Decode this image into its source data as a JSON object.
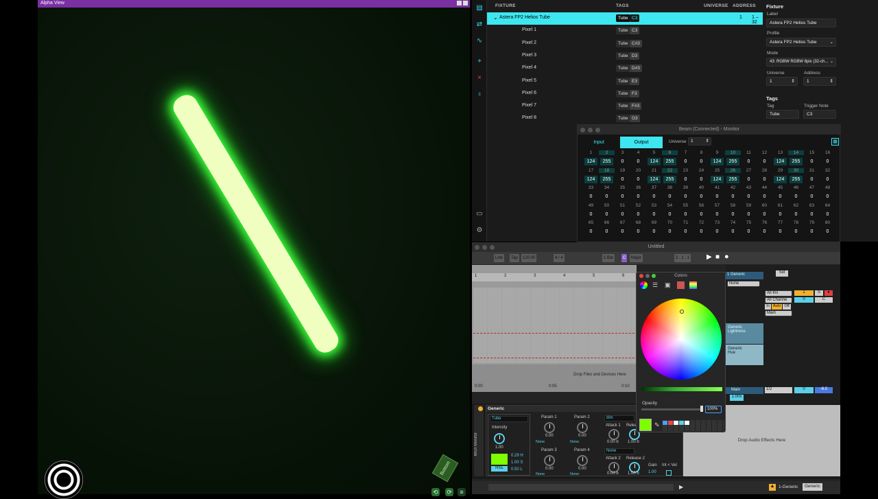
{
  "alpha_view": {
    "title": "Alpha View",
    "cube_label": "Bottom"
  },
  "fixtures": {
    "headers": {
      "fixture": "FIXTURE",
      "tags": "TAGS",
      "universe": "UNIVERSE",
      "address": "ADDRESS"
    },
    "rows": [
      {
        "name": "Astera FP2 Helios Tube",
        "tag": "Tube",
        "note": "C3",
        "universe": "1",
        "address": "1 – 32"
      },
      {
        "name": "Pixel 1",
        "tag": "Tube",
        "note": "C3"
      },
      {
        "name": "Pixel 2",
        "tag": "Tube",
        "note": "C#3"
      },
      {
        "name": "Pixel 3",
        "tag": "Tube",
        "note": "D3"
      },
      {
        "name": "Pixel 4",
        "tag": "Tube",
        "note": "D#3"
      },
      {
        "name": "Pixel 5",
        "tag": "Tube",
        "note": "E3"
      },
      {
        "name": "Pixel 6",
        "tag": "Tube",
        "note": "F3"
      },
      {
        "name": "Pixel 7",
        "tag": "Tube",
        "note": "F#3"
      },
      {
        "name": "Pixel 8",
        "tag": "Tube",
        "note": "G3"
      }
    ]
  },
  "inspector": {
    "heading": "Fixture",
    "label_caption": "Label",
    "label_value": "Astera FP2 Helios Tube",
    "profile_caption": "Profile",
    "profile_value": "Astera FP2 Helios Tube",
    "mode_caption": "Mode",
    "mode_value": "43: RGBW RGBW 8pix (32-ch...",
    "universe_caption": "Universe",
    "universe_value": "1",
    "address_caption": "Address",
    "address_value": "1",
    "tags_heading": "Tags",
    "tag_caption": "Tag",
    "tag_value": "Tube",
    "trigger_caption": "Trigger Note",
    "trigger_value": "C3"
  },
  "monitor": {
    "title": "Beam (Connected) - Monitor",
    "tab_input": "Input",
    "tab_output": "Output",
    "universe_label": "Universe",
    "universe_value": "1",
    "channels": [
      [
        124,
        255,
        0,
        0,
        124,
        255,
        0,
        0,
        124,
        255,
        0,
        0,
        124,
        255,
        0,
        0
      ],
      [
        124,
        255,
        0,
        0,
        124,
        255,
        0,
        0,
        124,
        255,
        0,
        0,
        124,
        255,
        0,
        0
      ],
      [
        0,
        0,
        0,
        0,
        0,
        0,
        0,
        0,
        0,
        0,
        0,
        0,
        0,
        0,
        0,
        0
      ],
      [
        0,
        0,
        0,
        0,
        0,
        0,
        0,
        0,
        0,
        0,
        0,
        0,
        0,
        0,
        0,
        0
      ],
      [
        0,
        0,
        0,
        0,
        0,
        0,
        0,
        0,
        0,
        0,
        0,
        0,
        0,
        0,
        0,
        0
      ]
    ]
  },
  "ableton": {
    "title": "Untitled",
    "link": "Link",
    "tap": "Tap",
    "tempo": "120.00",
    "signature": "4 / 4",
    "quant": "1 Bar",
    "key": "C",
    "scale": "Major",
    "position": "2 . 1 . 1",
    "ruler": [
      "1",
      "2",
      "3",
      "4",
      "5",
      "6"
    ],
    "time_start": "0:00",
    "time_mid": "0:05",
    "time_end": "0:10",
    "drop_files": "Drop Files and Devices Here",
    "drop_fx": "Drop Audio Effects Here",
    "track_name": "1 Generic",
    "track_input": "None",
    "ch_lightness": "Generic\nLightness",
    "ch_hue": "Generic\nHue",
    "all_ins": "All Ins",
    "all_channels": "All Channe",
    "main": "Main",
    "main_track": "Main",
    "ratio": "1/2",
    "vol_main": "-6.0",
    "vol_track": "0",
    "c_label": "C",
    "s_label": "S",
    "in_label": "In",
    "auto_label": "Auto",
    "off_label": "Off",
    "tempo_pct": "1.00x",
    "set_label": "Set",
    "device": {
      "title": "Generic",
      "side_label": "MIDI Monitor",
      "tag": "Tube",
      "intensity_label": "Intensity",
      "intensity_value": "1.00",
      "h": "0.29 H",
      "s": "1.00 S",
      "l": "0.50 L",
      "mode": "HSL",
      "param1": "Param 1",
      "param1_val": "0.00",
      "param1_sel": "None",
      "param2": "Param 2",
      "param2_val": "0.00",
      "param2_sel": "None",
      "param3": "Param 3",
      "param3_val": "0.00",
      "param3_sel": "None",
      "param4": "Param 4",
      "param4_val": "0.00",
      "param4_sel": "None",
      "dim": "dim",
      "attack1": "Attack 1",
      "attack1_val": "0.00 b",
      "release1": "Release 1",
      "release1_val": "1.00 b",
      "sel_none": "None",
      "attack2": "Attack 2",
      "attack2_val": "0.00 b",
      "release2": "Release 2",
      "release2_val": "1.00 b",
      "gain": "Gain",
      "gain_val": "1.00",
      "int_vel": "Int < Vel"
    },
    "status_track": "1-Generic",
    "status_device": "Generic"
  },
  "colors": {
    "title": "Colors",
    "opacity_label": "Opacity",
    "opacity_value": "100%",
    "swatch_color": "#7eff00"
  }
}
